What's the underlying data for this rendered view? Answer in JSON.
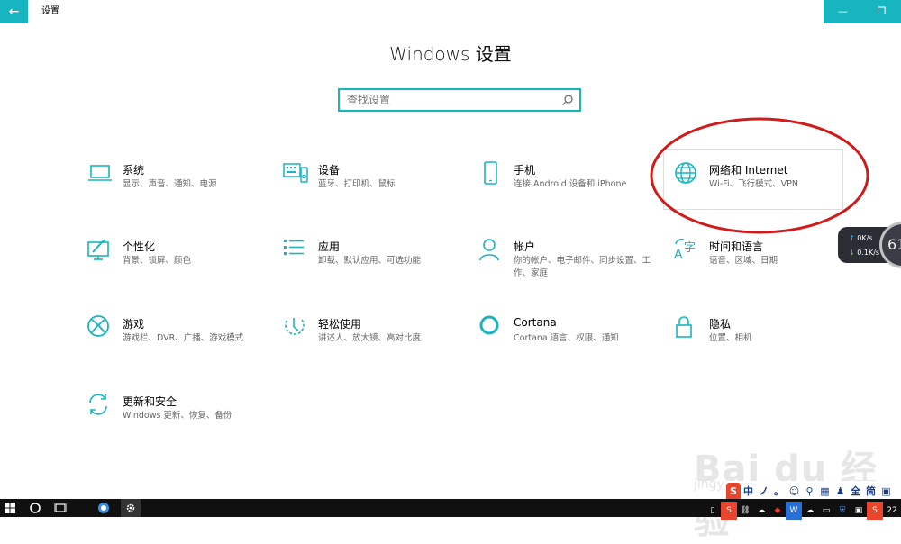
{
  "titlebar": {
    "app_title": "设置",
    "back_glyph": "←",
    "minimize_glyph": "—",
    "restore_glyph": "❐"
  },
  "page_title": "Windows 设置",
  "search": {
    "placeholder": "查找设置"
  },
  "accent_color": "#17b5c0",
  "tiles": [
    {
      "icon": "laptop-icon",
      "title": "系统",
      "desc": "显示、声音、通知、电源"
    },
    {
      "icon": "keyboard-icon",
      "title": "设备",
      "desc": "蓝牙、打印机、鼠标"
    },
    {
      "icon": "phone-icon",
      "title": "手机",
      "desc": "连接 Android 设备和 iPhone"
    },
    {
      "icon": "globe-icon",
      "title": "网络和 Internet",
      "desc": "Wi-Fi、飞行模式、VPN"
    },
    {
      "icon": "personalization-icon",
      "title": "个性化",
      "desc": "背景、锁屏、颜色"
    },
    {
      "icon": "apps-list-icon",
      "title": "应用",
      "desc": "卸载、默认应用、可选功能"
    },
    {
      "icon": "person-icon",
      "title": "帐户",
      "desc": "你的帐户、电子邮件、同步设置、工作、家庭"
    },
    {
      "icon": "language-icon",
      "title": "时间和语言",
      "desc": "语音、区域、日期"
    },
    {
      "icon": "xbox-icon",
      "title": "游戏",
      "desc": "游戏栏、DVR、广播、游戏模式"
    },
    {
      "icon": "ease-of-access-icon",
      "title": "轻松使用",
      "desc": "讲述人、放大镜、高对比度"
    },
    {
      "icon": "cortana-icon",
      "title": "Cortana",
      "desc": "Cortana 语言、权限、通知"
    },
    {
      "icon": "lock-icon",
      "title": "隐私",
      "desc": "位置、相机"
    },
    {
      "icon": "update-icon",
      "title": "更新和安全",
      "desc": "Windows 更新、恢复、备份"
    }
  ],
  "net_widget": {
    "up": "0K/s",
    "down": "0.1K/s",
    "percent": "61"
  },
  "watermark": {
    "text": "Bai du 经验",
    "sub": "jingyan"
  },
  "ime_bar": [
    "S",
    "中",
    "ノ",
    "。",
    "☺",
    "♀",
    "▦",
    "♟",
    "全",
    "简",
    "▣"
  ],
  "taskbar": {
    "clock": "22"
  }
}
